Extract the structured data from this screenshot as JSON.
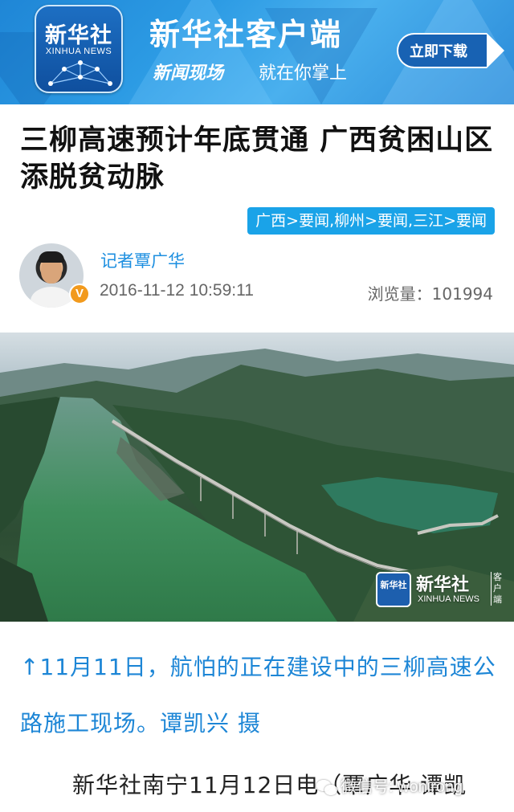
{
  "banner": {
    "logo_cn": "新华社",
    "logo_en": "XINHUA NEWS",
    "title": "新华社客户端",
    "subtitle_bold": "新闻现场",
    "subtitle": "就在你掌上",
    "download_label": "立即下载",
    "colors": {
      "primary": "#1f86d6",
      "button": "#1862b3"
    }
  },
  "article": {
    "headline": "三柳高速预计年底贯通 广西贫困山区添脱贫动脉",
    "tags": "广西>要闻,柳州>要闻,三江>要闻",
    "reporter": "记者覃广华",
    "verified_badge": "V",
    "published": "2016-11-12 10:59:11",
    "views_label": "浏览量：",
    "views_count": "101994"
  },
  "photo": {
    "watermark_cn": "新华社",
    "watermark_en": "XINHUA NEWS",
    "watermark_side": "客户端"
  },
  "caption": "↑11月11日，航怕的正在建设中的三柳高速公路施工现场。谭凯兴 摄",
  "body_start": "新华社南宁11月12日电（覃广华 谭凯",
  "overlay": {
    "wechat_text": "微信号: wonirong"
  }
}
